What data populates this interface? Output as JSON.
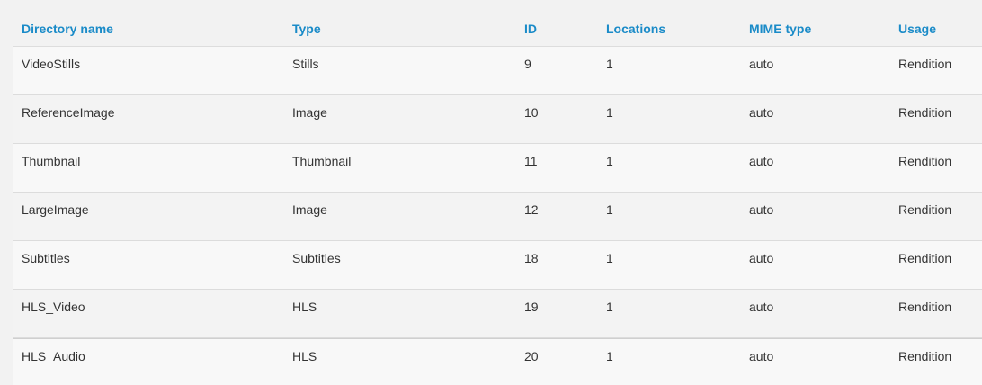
{
  "table": {
    "headers": [
      "Directory name",
      "Type",
      "ID",
      "Locations",
      "MIME type",
      "Usage"
    ],
    "rows": [
      [
        "VideoStills",
        "Stills",
        "9",
        "1",
        "auto",
        "Rendition"
      ],
      [
        "ReferenceImage",
        "Image",
        "10",
        "1",
        "auto",
        "Rendition"
      ],
      [
        "Thumbnail",
        "Thumbnail",
        "11",
        "1",
        "auto",
        "Rendition"
      ],
      [
        "LargeImage",
        "Image",
        "12",
        "1",
        "auto",
        "Rendition"
      ],
      [
        "Subtitles",
        "Subtitles",
        "18",
        "1",
        "auto",
        "Rendition"
      ],
      [
        "HLS_Video",
        "HLS",
        "19",
        "1",
        "auto",
        "Rendition"
      ],
      [
        "HLS_Audio",
        "HLS",
        "20",
        "1",
        "auto",
        "Rendition"
      ]
    ]
  },
  "colors": {
    "header_text": "#1a8bc8",
    "body_text": "#333333",
    "background": "#f2f2f2"
  }
}
